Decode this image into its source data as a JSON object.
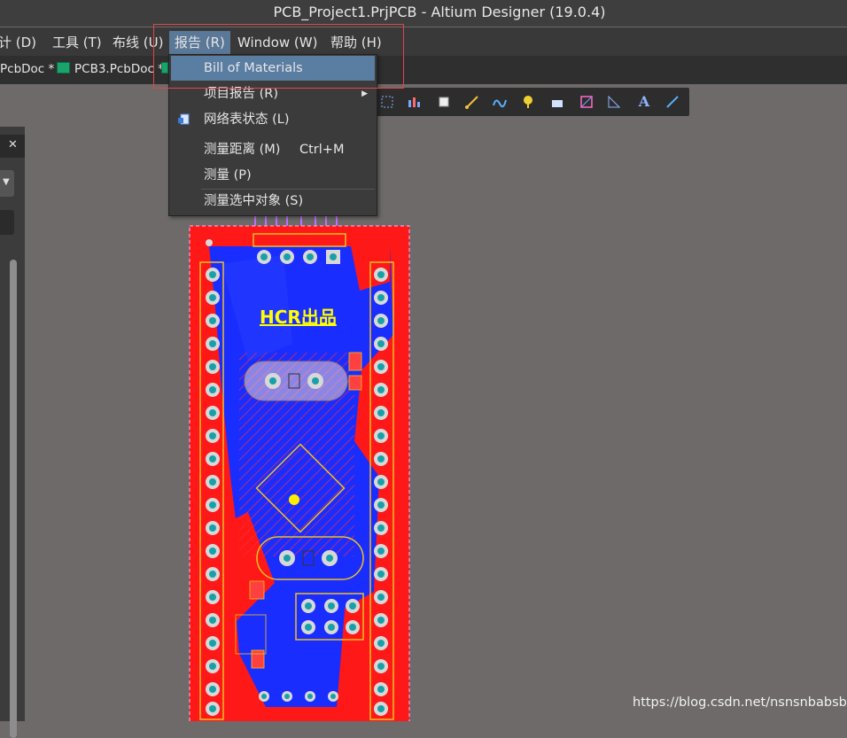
{
  "window": {
    "title": "PCB_Project1.PrjPCB - Altium Designer (19.0.4)"
  },
  "menubar": {
    "items": [
      {
        "label": "计 (D)"
      },
      {
        "label": "工具 (T)"
      },
      {
        "label": "布线 (U)"
      },
      {
        "label": "报告 (R)"
      },
      {
        "label": "Window (W)"
      },
      {
        "label": "帮助 (H)"
      }
    ]
  },
  "tabs": [
    {
      "label": "PcbDoc *"
    },
    {
      "label": "PCB3.PcbDoc *"
    }
  ],
  "report_menu": {
    "items": [
      {
        "label": "Bill of Materials"
      },
      {
        "label": "项目报告 (R)"
      },
      {
        "label": "网络表状态 (L)"
      },
      {
        "label": "测量距离 (M)",
        "shortcut": "Ctrl+M"
      },
      {
        "label": "测量 (P)"
      },
      {
        "label": "测量选中对象 (S)"
      }
    ]
  },
  "board": {
    "logo_text": "HCR出品"
  },
  "watermark": "https://blog.csdn.net/nsnsnbabsb",
  "colors": {
    "top_layer": "#ff1a1a",
    "bottom_layer": "#1530ff",
    "silk": "#ffff00",
    "selection": "#5a7da2",
    "annotation": "#e0464b"
  }
}
